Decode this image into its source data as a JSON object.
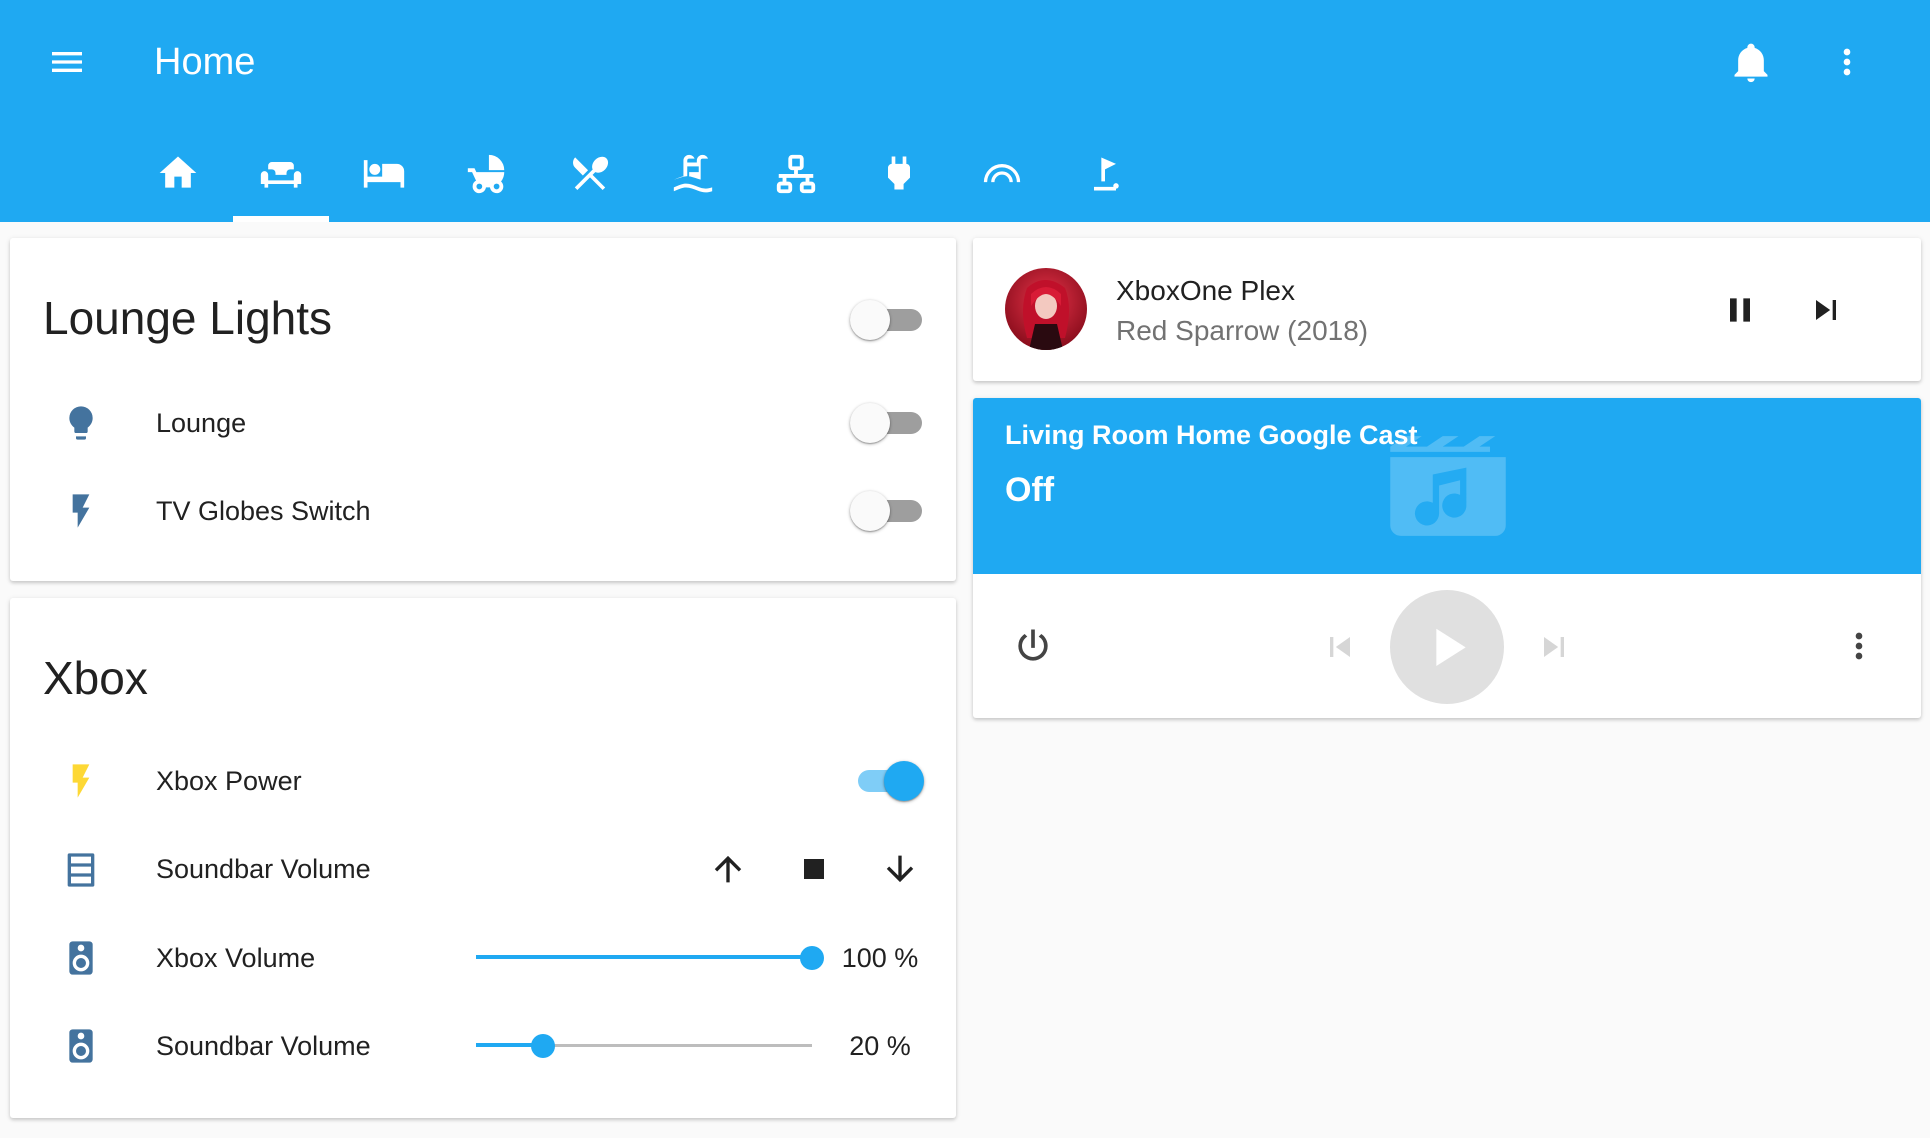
{
  "header": {
    "title": "Home",
    "menu_icon": "menu-icon",
    "notifications_icon": "bell-icon",
    "overflow_icon": "dots-vertical-icon"
  },
  "tabs": [
    {
      "icon": "home-icon",
      "selected": false
    },
    {
      "icon": "sofa-icon",
      "selected": true
    },
    {
      "icon": "bed-icon",
      "selected": false
    },
    {
      "icon": "baby-carriage-icon",
      "selected": false
    },
    {
      "icon": "silverware-icon",
      "selected": false
    },
    {
      "icon": "pool-icon",
      "selected": false
    },
    {
      "icon": "lan-icon",
      "selected": false
    },
    {
      "icon": "power-plug-icon",
      "selected": false
    },
    {
      "icon": "wifi-arc-icon",
      "selected": false
    },
    {
      "icon": "golf-icon",
      "selected": false
    }
  ],
  "lounge_lights": {
    "title": "Lounge Lights",
    "master_on": false,
    "rows": [
      {
        "label": "Lounge",
        "icon": "lightbulb-icon",
        "on": false
      },
      {
        "label": "TV Globes Switch",
        "icon": "flash-icon",
        "on": false
      }
    ]
  },
  "xbox": {
    "title": "Xbox",
    "power": {
      "label": "Xbox Power",
      "icon": "flash-icon",
      "on": true
    },
    "soundbar_cover": {
      "label": "Soundbar Volume",
      "icon": "window-shutter-icon",
      "buttons": [
        "arrow-up-icon",
        "stop-icon",
        "arrow-down-icon"
      ]
    },
    "xbox_volume": {
      "label": "Xbox Volume",
      "icon": "speaker-icon",
      "value": 100,
      "display": "100 %"
    },
    "soundbar_volume": {
      "label": "Soundbar Volume",
      "icon": "speaker-icon",
      "value": 20,
      "display": "20 %"
    }
  },
  "media_player": {
    "name": "XboxOne Plex",
    "secondary": "Red Sparrow (2018)",
    "controls": [
      "pause-icon",
      "skip-next-icon"
    ]
  },
  "cast": {
    "name": "Living Room Home Google Cast",
    "state": "Off",
    "watermark_icon": "movie-music-icon",
    "controls": [
      "power-icon",
      "skip-previous-icon",
      "play-icon",
      "skip-next-icon",
      "dots-vertical-icon"
    ]
  },
  "colors": {
    "primary": "#1fa9f2",
    "icon_blue": "#44739e",
    "icon_active": "#fdd835",
    "background": "#fafafa"
  }
}
